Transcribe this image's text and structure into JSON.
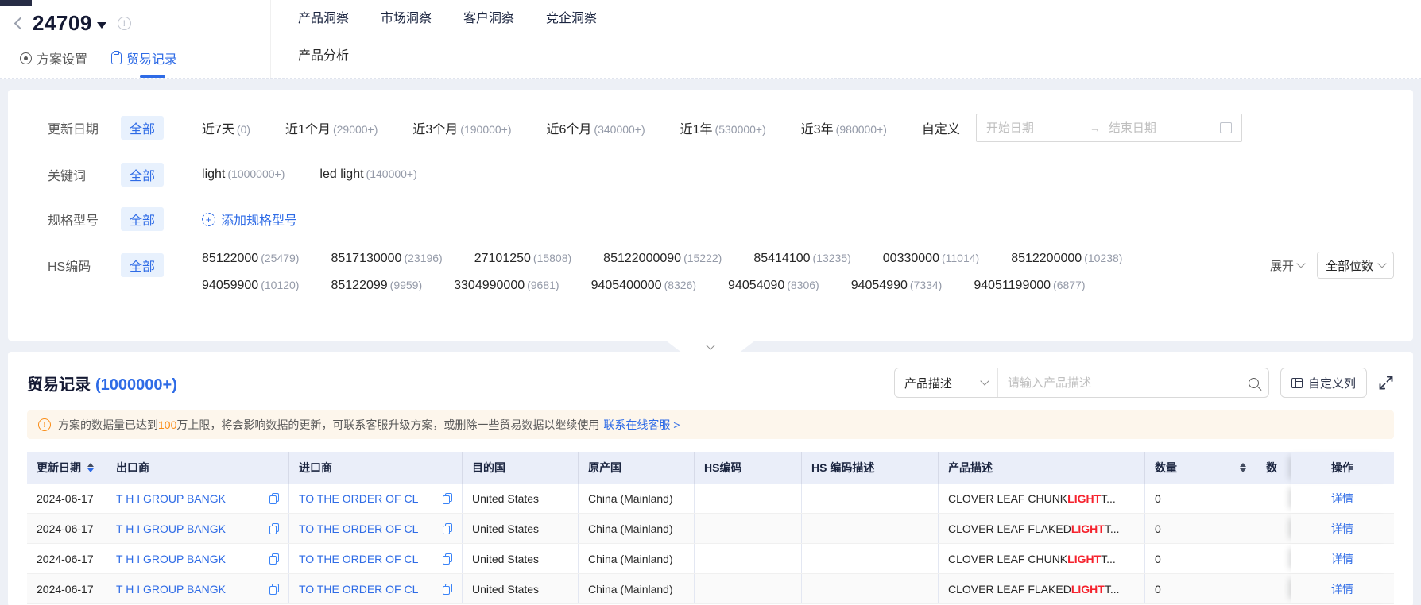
{
  "header": {
    "title": "24709",
    "nav_items": [
      "产品洞察",
      "市场洞察",
      "客户洞察",
      "竞企洞察"
    ],
    "sub_nav": "产品分析",
    "tabs": [
      {
        "label": "方案设置"
      },
      {
        "label": "贸易记录"
      }
    ]
  },
  "filters": {
    "all": "全部",
    "update_date": {
      "label": "更新日期",
      "options": [
        {
          "text": "近7天",
          "count": "(0)"
        },
        {
          "text": "近1个月",
          "count": "(29000+)"
        },
        {
          "text": "近3个月",
          "count": "(190000+)"
        },
        {
          "text": "近6个月",
          "count": "(340000+)"
        },
        {
          "text": "近1年",
          "count": "(530000+)"
        },
        {
          "text": "近3年",
          "count": "(980000+)"
        }
      ],
      "custom": "自定义",
      "start_placeholder": "开始日期",
      "end_placeholder": "结束日期"
    },
    "keyword": {
      "label": "关键词",
      "options": [
        {
          "text": "light",
          "count": "(1000000+)"
        },
        {
          "text": "led light",
          "count": "(140000+)"
        }
      ]
    },
    "spec": {
      "label": "规格型号",
      "add_label": "添加规格型号"
    },
    "hs_code": {
      "label": "HS编码",
      "row1": [
        {
          "text": "85122000",
          "count": "(25479)"
        },
        {
          "text": "8517130000",
          "count": "(23196)"
        },
        {
          "text": "27101250",
          "count": "(15808)"
        },
        {
          "text": "85122000090",
          "count": "(15222)"
        },
        {
          "text": "85414100",
          "count": "(13235)"
        },
        {
          "text": "00330000",
          "count": "(11014)"
        },
        {
          "text": "8512200000",
          "count": "(10238)"
        }
      ],
      "row2": [
        {
          "text": "94059900",
          "count": "(10120)"
        },
        {
          "text": "85122099",
          "count": "(9959)"
        },
        {
          "text": "3304990000",
          "count": "(9681)"
        },
        {
          "text": "9405400000",
          "count": "(8326)"
        },
        {
          "text": "94054090",
          "count": "(8306)"
        },
        {
          "text": "94054990",
          "count": "(7334)"
        },
        {
          "text": "94051199000",
          "count": "(6877)"
        }
      ],
      "expand": "展开",
      "digits": "全部位数"
    }
  },
  "records": {
    "title": "贸易记录",
    "count": "(1000000+)",
    "search_type": "产品描述",
    "search_placeholder": "请输入产品描述",
    "custom_columns": "自定义列",
    "warning": {
      "text_before": "方案的数据量已达到",
      "highlight": "100",
      "text_after": "万上限，将会影响数据的更新，可联系客服升级方案，或删除一些贸易数据以继续使用",
      "link": "联系在线客服 >"
    },
    "table": {
      "headers": {
        "date": "更新日期",
        "exporter": "出口商",
        "importer": "进口商",
        "dest": "目的国",
        "origin": "原产国",
        "hs": "HS编码",
        "hs_desc": "HS 编码描述",
        "desc": "产品描述",
        "qty": "数量",
        "qty2": "数",
        "action": "操作"
      },
      "rows": [
        {
          "date": "2024-06-17",
          "exporter": "T H I GROUP BANGK",
          "importer": "TO THE ORDER OF CL",
          "dest": "United States",
          "origin": "China (Mainland)",
          "hs": "",
          "hs_desc": "",
          "desc_pre": "CLOVER LEAF CHUNK ",
          "desc_hl": "LIGHT",
          "desc_post": " T...",
          "qty": "0",
          "qty2": "",
          "action": "详情"
        },
        {
          "date": "2024-06-17",
          "exporter": "T H I GROUP BANGK",
          "importer": "TO THE ORDER OF CL",
          "dest": "United States",
          "origin": "China (Mainland)",
          "hs": "",
          "hs_desc": "",
          "desc_pre": "CLOVER LEAF FLAKED ",
          "desc_hl": "LIGHT",
          "desc_post": " T...",
          "qty": "0",
          "qty2": "",
          "action": "详情"
        },
        {
          "date": "2024-06-17",
          "exporter": "T H I GROUP BANGK",
          "importer": "TO THE ORDER OF CL",
          "dest": "United States",
          "origin": "China (Mainland)",
          "hs": "",
          "hs_desc": "",
          "desc_pre": "CLOVER LEAF CHUNK ",
          "desc_hl": "LIGHT",
          "desc_post": " T...",
          "qty": "0",
          "qty2": "",
          "action": "详情"
        },
        {
          "date": "2024-06-17",
          "exporter": "T H I GROUP BANGK",
          "importer": "TO THE ORDER OF CL",
          "dest": "United States",
          "origin": "China (Mainland)",
          "hs": "",
          "hs_desc": "",
          "desc_pre": "CLOVER LEAF FLAKED ",
          "desc_hl": "LIGHT",
          "desc_post": " T...",
          "qty": "0",
          "qty2": "",
          "action": "详情"
        }
      ]
    }
  }
}
